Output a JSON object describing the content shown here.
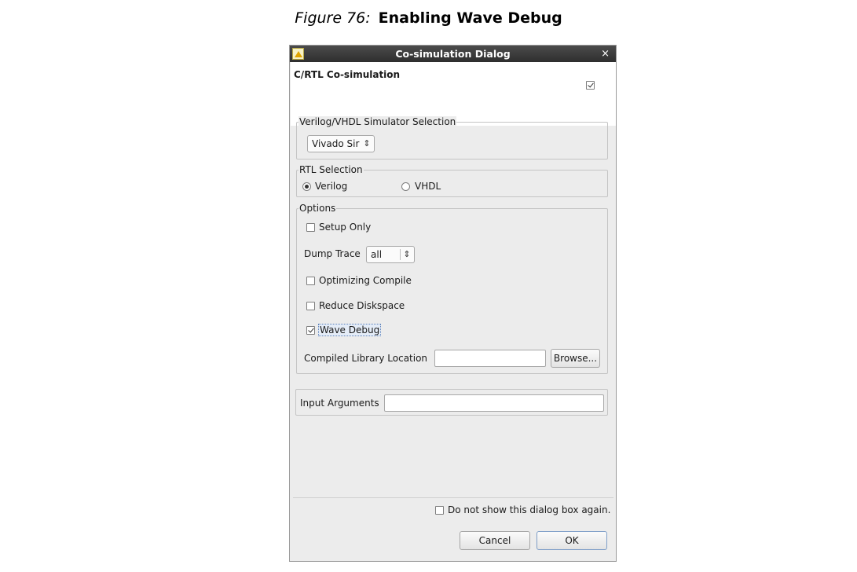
{
  "caption": {
    "label": "Figure 76:",
    "title": "Enabling Wave Debug"
  },
  "window": {
    "title": "Co-simulation Dialog",
    "close_glyph": "×",
    "icon": "app-icon"
  },
  "header": {
    "title": "C/RTL Co-simulation",
    "checked": true
  },
  "simulator": {
    "legend": "Verilog/VHDL Simulator Selection",
    "selected": "Vivado Sir"
  },
  "rtl": {
    "legend": "RTL Selection",
    "verilog_label": "Verilog",
    "vhdl_label": "VHDL",
    "selected": "Verilog"
  },
  "options": {
    "legend": "Options",
    "setup_only": {
      "label": "Setup Only",
      "checked": false
    },
    "dump_trace": {
      "label": "Dump Trace",
      "value": "all"
    },
    "optimizing_compile": {
      "label": "Optimizing Compile",
      "checked": false
    },
    "reduce_diskspace": {
      "label": "Reduce Diskspace",
      "checked": false
    },
    "wave_debug": {
      "label": "Wave Debug",
      "checked": true
    },
    "compiled_library": {
      "label": "Compiled Library Location",
      "value": "",
      "browse_label": "Browse..."
    }
  },
  "input_arguments": {
    "label": "Input Arguments",
    "value": ""
  },
  "footer": {
    "dont_show_label": "Do not show this dialog box again.",
    "dont_show_checked": false,
    "cancel_label": "Cancel",
    "ok_label": "OK"
  },
  "colors": {
    "titlebar": "#3a3a3a",
    "dialog_bg": "#ececec",
    "focus_highlight": "#e4ecf7"
  }
}
